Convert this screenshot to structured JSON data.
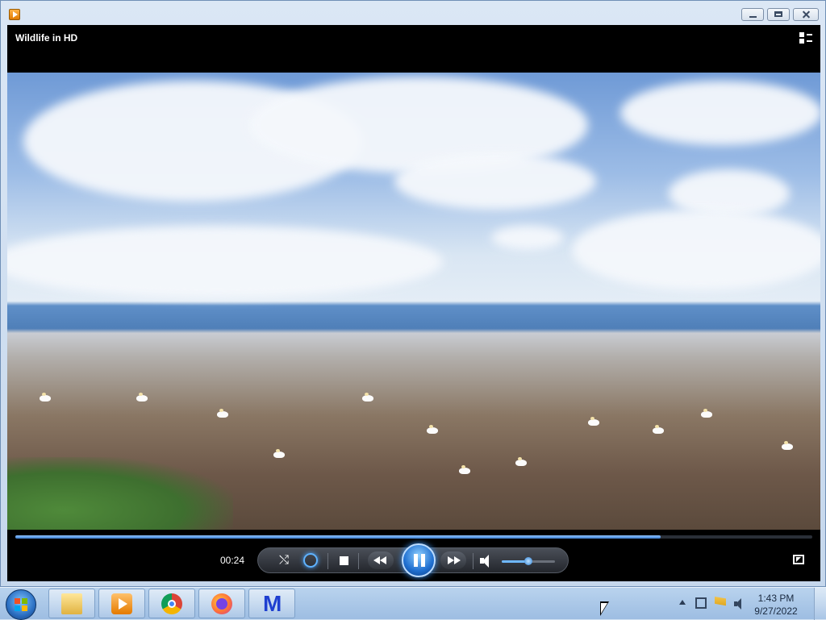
{
  "window": {
    "app_icon": "windows-media-player-icon",
    "controls": [
      "minimize-icon",
      "maximize-icon",
      "close-icon"
    ]
  },
  "player": {
    "media_title": "Wildlife in HD",
    "elapsed_time": "00:24",
    "seek_progress": 0.81,
    "volume_level": 0.5,
    "state": "playing",
    "icons": {
      "switch_to_library": "switch-to-library-icon",
      "shuffle": "shuffle-icon",
      "repeat": "repeat-icon",
      "stop": "stop-icon",
      "previous": "previous-icon",
      "play_pause": "pause-icon",
      "next": "next-icon",
      "mute": "volume-icon",
      "fullscreen": "fullscreen-icon"
    },
    "accent_color": "#3c7fd1"
  },
  "taskbar": {
    "start_icon": "windows-start-icon",
    "pinned": [
      {
        "name": "file-explorer",
        "icon": "folder-icon"
      },
      {
        "name": "windows-media-player",
        "icon": "media-player-icon"
      },
      {
        "name": "chrome",
        "icon": "chrome-icon"
      },
      {
        "name": "firefox",
        "icon": "firefox-icon"
      },
      {
        "name": "malwarebytes",
        "icon": "malwarebytes-icon"
      }
    ],
    "clock": {
      "time": "1:43 PM",
      "date": "9/27/2022"
    }
  }
}
